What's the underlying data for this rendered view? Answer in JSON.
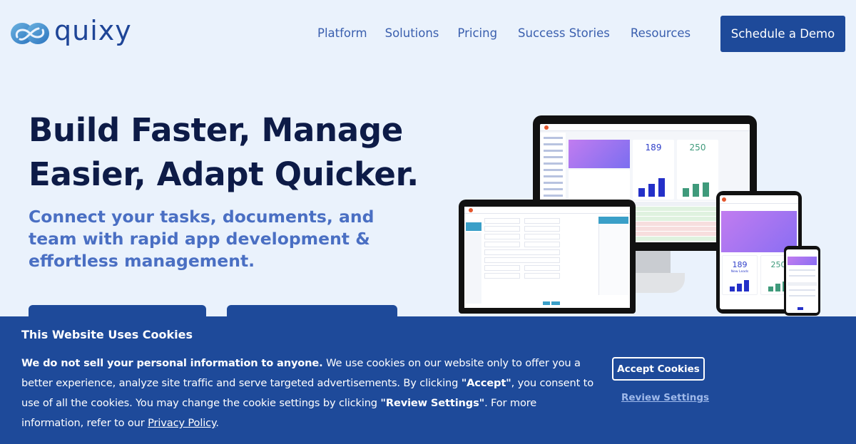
{
  "brand": {
    "name": "quixy",
    "primary_color": "#1e4a9a",
    "text_color": "#0d1b47",
    "accent_color": "#4a6fc3"
  },
  "nav": {
    "items": [
      {
        "label": "Platform"
      },
      {
        "label": "Solutions"
      },
      {
        "label": "Pricing"
      },
      {
        "label": "Success Stories"
      },
      {
        "label": "Resources"
      }
    ],
    "cta_label": "Schedule a Demo"
  },
  "hero": {
    "title_line1": "Build Faster, Manage",
    "title_line2": "Easier, Adapt Quicker.",
    "subtitle": "Connect your tasks, documents, and team with rapid app development & effortless management."
  },
  "mockup": {
    "monitor_stat1": "189",
    "monitor_stat2": "250",
    "tablet_stat1": "189",
    "tablet_stat1_label": "New Leads",
    "tablet_stat2": "250",
    "phone_stat": ""
  },
  "cookie_banner": {
    "title": "This Website Uses Cookies",
    "text_bold_intro": "We do not sell your personal information to anyone.",
    "text_part1": " We use cookies on our website only to offer you a better experience, analyze site traffic and serve targeted advertisements. By clicking ",
    "text_accept_quote": "\"Accept\"",
    "text_part2": ", you consent to use of all the cookies. You may change the cookie settings by clicking ",
    "text_review_quote": "\"Review Settings\"",
    "text_part3": ". For more information, refer to our ",
    "privacy_link": "Privacy Policy",
    "text_end": ".",
    "accept_label": "Accept Cookies",
    "review_label": "Review Settings"
  }
}
